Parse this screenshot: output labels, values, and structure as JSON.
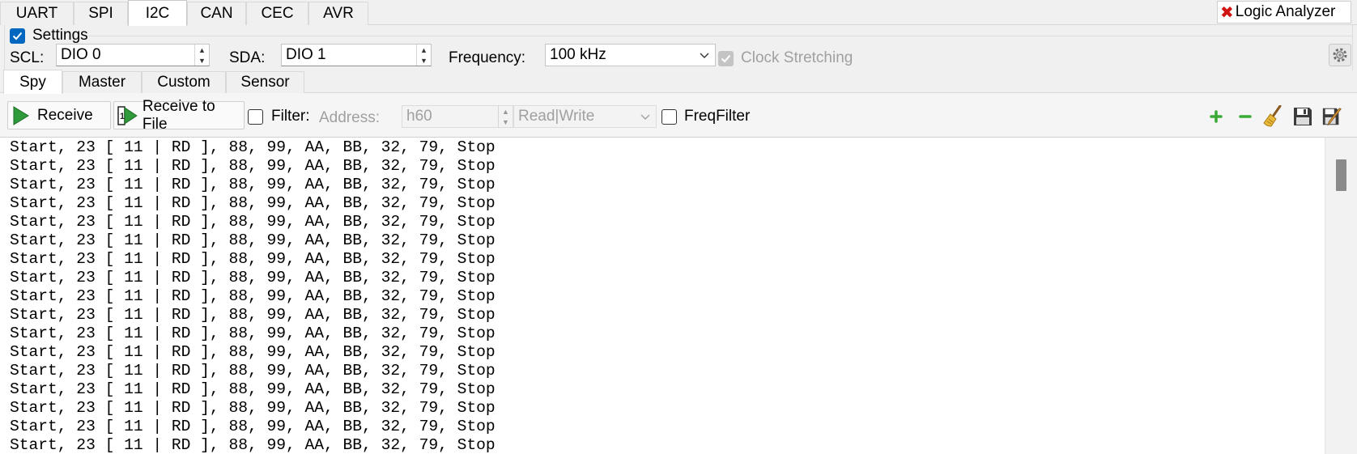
{
  "protocol_tabs": [
    "UART",
    "SPI",
    "I2C",
    "CAN",
    "CEC",
    "AVR"
  ],
  "active_protocol": "I2C",
  "logic_analyzer": {
    "label": "Logic Analyzer"
  },
  "settings": {
    "legend": "Settings",
    "checked": true,
    "scl_label": "SCL:",
    "scl_value": "DIO 0",
    "sda_label": "SDA:",
    "sda_value": "DIO 1",
    "frequency_label": "Frequency:",
    "frequency_value": "100 kHz",
    "clock_stretching_label": "Clock Stretching"
  },
  "sub_tabs": [
    "Spy",
    "Master",
    "Custom",
    "Sensor"
  ],
  "active_sub_tab": "Spy",
  "toolbar": {
    "receive_label": "Receive",
    "receive_to_file_label": "Receive to File",
    "filter_label": "Filter:",
    "address_label": "Address:",
    "address_value": "h60",
    "rw_value": "Read|Write",
    "freq_filter_label": "FreqFilter",
    "icons": [
      "add-icon",
      "remove-icon",
      "broom-icon",
      "save-icon",
      "edit-icon"
    ]
  },
  "log": {
    "lines": [
      "Start, 23 [ 11 | RD ], 88, 99, AA, BB, 32, 79, Stop",
      "Start, 23 [ 11 | RD ], 88, 99, AA, BB, 32, 79, Stop",
      "Start, 23 [ 11 | RD ], 88, 99, AA, BB, 32, 79, Stop",
      "Start, 23 [ 11 | RD ], 88, 99, AA, BB, 32, 79, Stop",
      "Start, 23 [ 11 | RD ], 88, 99, AA, BB, 32, 79, Stop",
      "Start, 23 [ 11 | RD ], 88, 99, AA, BB, 32, 79, Stop",
      "Start, 23 [ 11 | RD ], 88, 99, AA, BB, 32, 79, Stop",
      "Start, 23 [ 11 | RD ], 88, 99, AA, BB, 32, 79, Stop",
      "Start, 23 [ 11 | RD ], 88, 99, AA, BB, 32, 79, Stop",
      "Start, 23 [ 11 | RD ], 88, 99, AA, BB, 32, 79, Stop",
      "Start, 23 [ 11 | RD ], 88, 99, AA, BB, 32, 79, Stop",
      "Start, 23 [ 11 | RD ], 88, 99, AA, BB, 32, 79, Stop",
      "Start, 23 [ 11 | RD ], 88, 99, AA, BB, 32, 79, Stop",
      "Start, 23 [ 11 | RD ], 88, 99, AA, BB, 32, 79, Stop",
      "Start, 23 [ 11 | RD ], 88, 99, AA, BB, 32, 79, Stop",
      "Start, 23 [ 11 | RD ], 88, 99, AA, BB, 32, 79, Stop",
      "Start, 23 [ 11 | RD ], 88, 99, AA, BB, 32, 79, Stop"
    ]
  },
  "colors": {
    "accent": "#0067c0",
    "play_green": "#2e9a3a",
    "add_green": "#3aa935",
    "remove_green": "#3aa935",
    "close_red": "#d01515"
  }
}
